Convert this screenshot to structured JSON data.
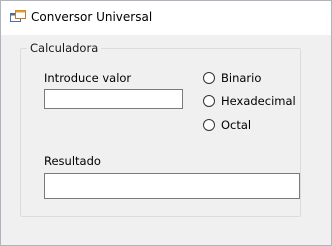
{
  "window": {
    "title": "Conversor Universal",
    "icon": "windows-form-icon"
  },
  "groupbox": {
    "label": "Calculadora"
  },
  "input": {
    "label": "Introduce valor",
    "value": ""
  },
  "radios": [
    {
      "label": "Binario",
      "checked": false
    },
    {
      "label": "Hexadecimal",
      "checked": false
    },
    {
      "label": "Octal",
      "checked": false
    }
  ],
  "result": {
    "label": "Resultado",
    "value": ""
  },
  "colors": {
    "window_background": "#f0f0f0",
    "titlebar_background": "#ffffff",
    "textbox_border": "#7a7a7a",
    "groupbox_border": "#dcdcdc"
  }
}
